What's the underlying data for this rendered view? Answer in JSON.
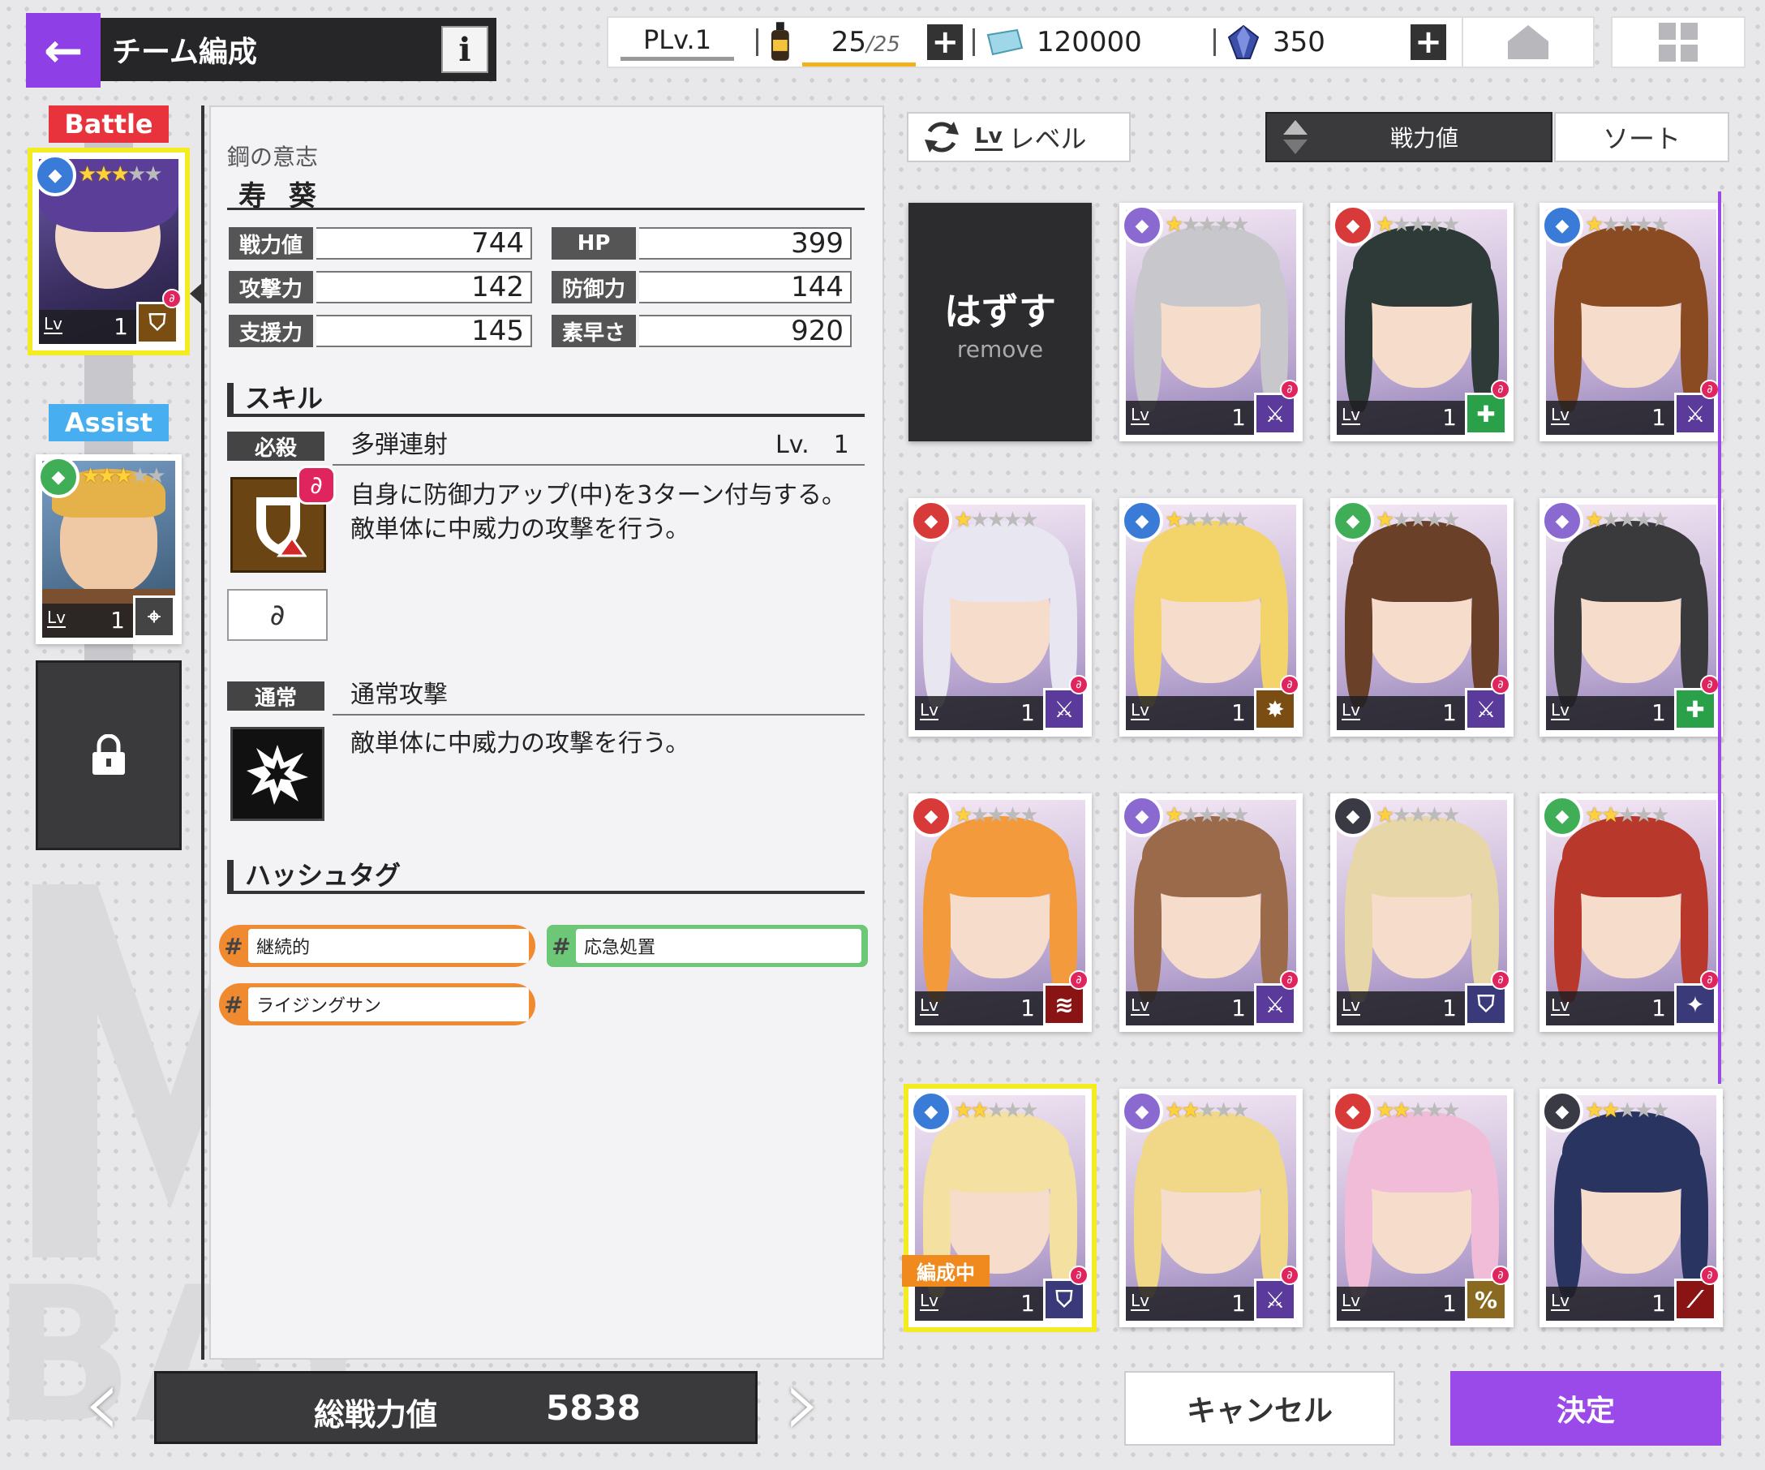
{
  "header": {
    "back_icon": "back-arrow-icon",
    "title": "チーム編成",
    "info_label": "i"
  },
  "resources": {
    "player_level": "PLv.1",
    "stamina": "25",
    "stamina_max": "/25",
    "stamina_fill": 1.0,
    "coins": "120000",
    "gems": "350"
  },
  "team": {
    "battle_label": "Battle",
    "assist_label": "Assist",
    "battle_card": {
      "stars": 3,
      "level": "1",
      "attr": "blue",
      "role": "shield"
    },
    "assist_card": {
      "stars": 3,
      "level": "1",
      "attr": "green",
      "role": "target"
    },
    "lock_icon": "lock-icon"
  },
  "detail": {
    "subtitle": "鋼の意志",
    "name": "寿 葵",
    "stats": [
      {
        "label": "戦力値",
        "value": "744"
      },
      {
        "label": "HP",
        "value": "399"
      },
      {
        "label": "攻撃力",
        "value": "142"
      },
      {
        "label": "防御力",
        "value": "144"
      },
      {
        "label": "支援力",
        "value": "145"
      },
      {
        "label": "素早さ",
        "value": "920"
      }
    ],
    "skill_section": "スキル",
    "special": {
      "badge": "必殺",
      "name": "多弾連射",
      "level": "Lv.　1",
      "desc1": "自身に防御力アップ(中)を3ターン付与する。",
      "desc2": "敵単体に中威力の攻撃を行う。"
    },
    "normal": {
      "badge": "通常",
      "name": "通常攻撃",
      "desc": "敵単体に中威力の攻撃を行う。"
    },
    "hashtag_section": "ハッシュタグ",
    "hashtags": [
      {
        "label": "継続的",
        "color": "#f08a30"
      },
      {
        "label": "応急処置",
        "color": "#6cc876"
      },
      {
        "label": "ライジングサン",
        "color": "#f08a30"
      }
    ]
  },
  "footer": {
    "total_label": "総戦力値",
    "total_value": "5838",
    "cancel": "キャンセル",
    "confirm": "決定"
  },
  "toolbar": {
    "level_prefix": "Lv",
    "level_label": "レベル",
    "sort_key": "戦力値",
    "sort_label": "ソート"
  },
  "remove": {
    "label": "はずす",
    "sub": "remove"
  },
  "roster": [
    {
      "stars": 1,
      "attr": "purple",
      "role": "sword",
      "level": "1",
      "hair": "#c8c8cc"
    },
    {
      "stars": 1,
      "attr": "red",
      "role": "heal",
      "level": "1",
      "hair": "#2e3a38"
    },
    {
      "stars": 1,
      "attr": "blue",
      "role": "sword",
      "level": "1",
      "hair": "#8a4a22"
    },
    {
      "stars": 1,
      "attr": "red",
      "role": "sword",
      "level": "1",
      "hair": "#e8e6f0"
    },
    {
      "stars": 1,
      "attr": "blue",
      "role": "burst",
      "level": "1",
      "hair": "#f3d46a"
    },
    {
      "stars": 1,
      "attr": "green",
      "role": "sword",
      "level": "1",
      "hair": "#6a4028"
    },
    {
      "stars": 1,
      "attr": "purple",
      "role": "heal",
      "level": "1",
      "hair": "#3a3a3c"
    },
    {
      "stars": 1,
      "attr": "red",
      "role": "claw",
      "level": "1",
      "hair": "#f29a3c"
    },
    {
      "stars": 1,
      "attr": "purple",
      "role": "sword",
      "level": "1",
      "hair": "#9a6a4a"
    },
    {
      "stars": 1,
      "attr": "dark",
      "role": "shield",
      "level": "1",
      "hair": "#e6d6a8"
    },
    {
      "stars": 2,
      "attr": "green",
      "role": "star",
      "level": "1",
      "hair": "#b8382c"
    },
    {
      "stars": 2,
      "attr": "blue",
      "role": "shield",
      "level": "1",
      "hair": "#f4e0a0",
      "badge": "編成中"
    },
    {
      "stars": 2,
      "attr": "purple",
      "role": "sword",
      "level": "1",
      "hair": "#f0d888"
    },
    {
      "stars": 2,
      "attr": "red",
      "role": "debuff",
      "level": "1",
      "hair": "#f0bcd8"
    },
    {
      "stars": 2,
      "attr": "dark",
      "role": "slash",
      "level": "1",
      "hair": "#2a3460"
    }
  ],
  "colors": {
    "accent": "#8e3fe6",
    "battle": "#e8323c",
    "assist": "#47aef0"
  }
}
